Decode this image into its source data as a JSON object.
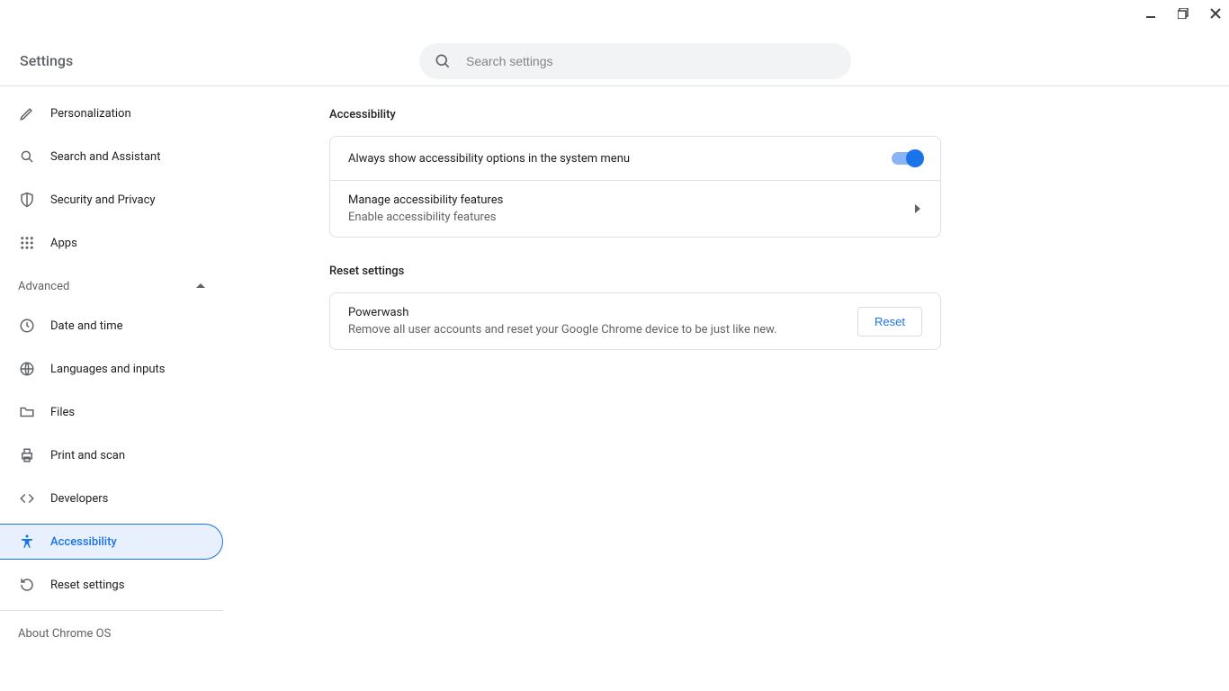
{
  "header": {
    "title": "Settings",
    "search_placeholder": "Search settings"
  },
  "sidebar": {
    "items_top": [
      {
        "icon": "pencil",
        "label": "Personalization"
      },
      {
        "icon": "search",
        "label": "Search and Assistant"
      },
      {
        "icon": "shield",
        "label": "Security and Privacy"
      },
      {
        "icon": "apps",
        "label": "Apps"
      }
    ],
    "advanced_label": "Advanced",
    "items_advanced": [
      {
        "icon": "clock",
        "label": "Date and time"
      },
      {
        "icon": "globe",
        "label": "Languages and inputs"
      },
      {
        "icon": "folder",
        "label": "Files"
      },
      {
        "icon": "printer",
        "label": "Print and scan"
      },
      {
        "icon": "code",
        "label": "Developers"
      },
      {
        "icon": "accessibility",
        "label": "Accessibility",
        "selected": true
      },
      {
        "icon": "reset",
        "label": "Reset settings"
      }
    ],
    "about_label": "About Chrome OS"
  },
  "main": {
    "section1_title": "Accessibility",
    "row1_label": "Always show accessibility options in the system menu",
    "row2_label": "Manage accessibility features",
    "row2_sub": "Enable accessibility features",
    "section2_title": "Reset settings",
    "row3_label": "Powerwash",
    "row3_sub": "Remove all user accounts and reset your Google Chrome device to be just like new.",
    "reset_button": "Reset"
  }
}
